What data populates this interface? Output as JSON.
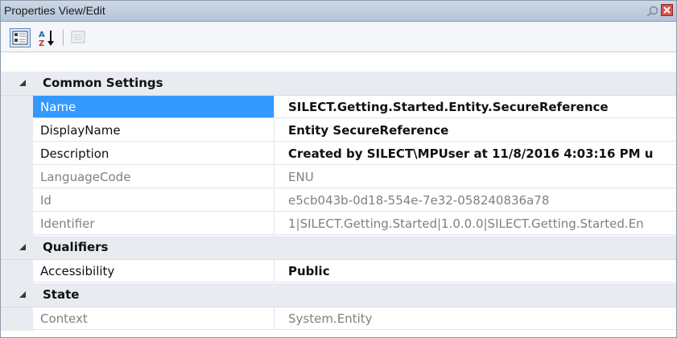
{
  "window": {
    "title": "Properties View/Edit",
    "icons": {
      "pin": "pin-icon",
      "close": "close-icon"
    }
  },
  "toolbar": {
    "buttons": [
      {
        "name": "categorized-button",
        "icon": "categorized-icon",
        "active": true
      },
      {
        "name": "alphabetical-button",
        "icon": "sort-az-icon",
        "active": false
      },
      {
        "name": "property-pages-button",
        "icon": "property-pages-icon",
        "active": false,
        "disabled": true
      }
    ]
  },
  "colors": {
    "selection": "#3399ff",
    "category_background": "#e8ebf0",
    "readonly_text": "#808080"
  },
  "categories": [
    {
      "label": "Common Settings",
      "expanded": true,
      "properties": [
        {
          "name": "Name",
          "value": "SILECT.Getting.Started.Entity.SecureReference",
          "selected": true,
          "bold": true,
          "readonly": false
        },
        {
          "name": "DisplayName",
          "value": "Entity SecureReference",
          "selected": false,
          "bold": true,
          "readonly": false
        },
        {
          "name": "Description",
          "value": "Created by SILECT\\MPUser at 11/8/2016 4:03:16 PM u",
          "selected": false,
          "bold": true,
          "readonly": false
        },
        {
          "name": "LanguageCode",
          "value": "ENU",
          "selected": false,
          "bold": false,
          "readonly": true
        },
        {
          "name": "Id",
          "value": "e5cb043b-0d18-554e-7e32-058240836a78",
          "selected": false,
          "bold": false,
          "readonly": true
        },
        {
          "name": "Identifier",
          "value": "1|SILECT.Getting.Started|1.0.0.0|SILECT.Getting.Started.En",
          "selected": false,
          "bold": false,
          "readonly": true
        }
      ]
    },
    {
      "label": "Qualifiers",
      "expanded": true,
      "properties": [
        {
          "name": "Accessibility",
          "value": "Public",
          "selected": false,
          "bold": true,
          "readonly": false
        }
      ]
    },
    {
      "label": "State",
      "expanded": true,
      "properties": [
        {
          "name": "Context",
          "value": "System.Entity",
          "selected": false,
          "bold": false,
          "readonly": true
        }
      ]
    }
  ]
}
